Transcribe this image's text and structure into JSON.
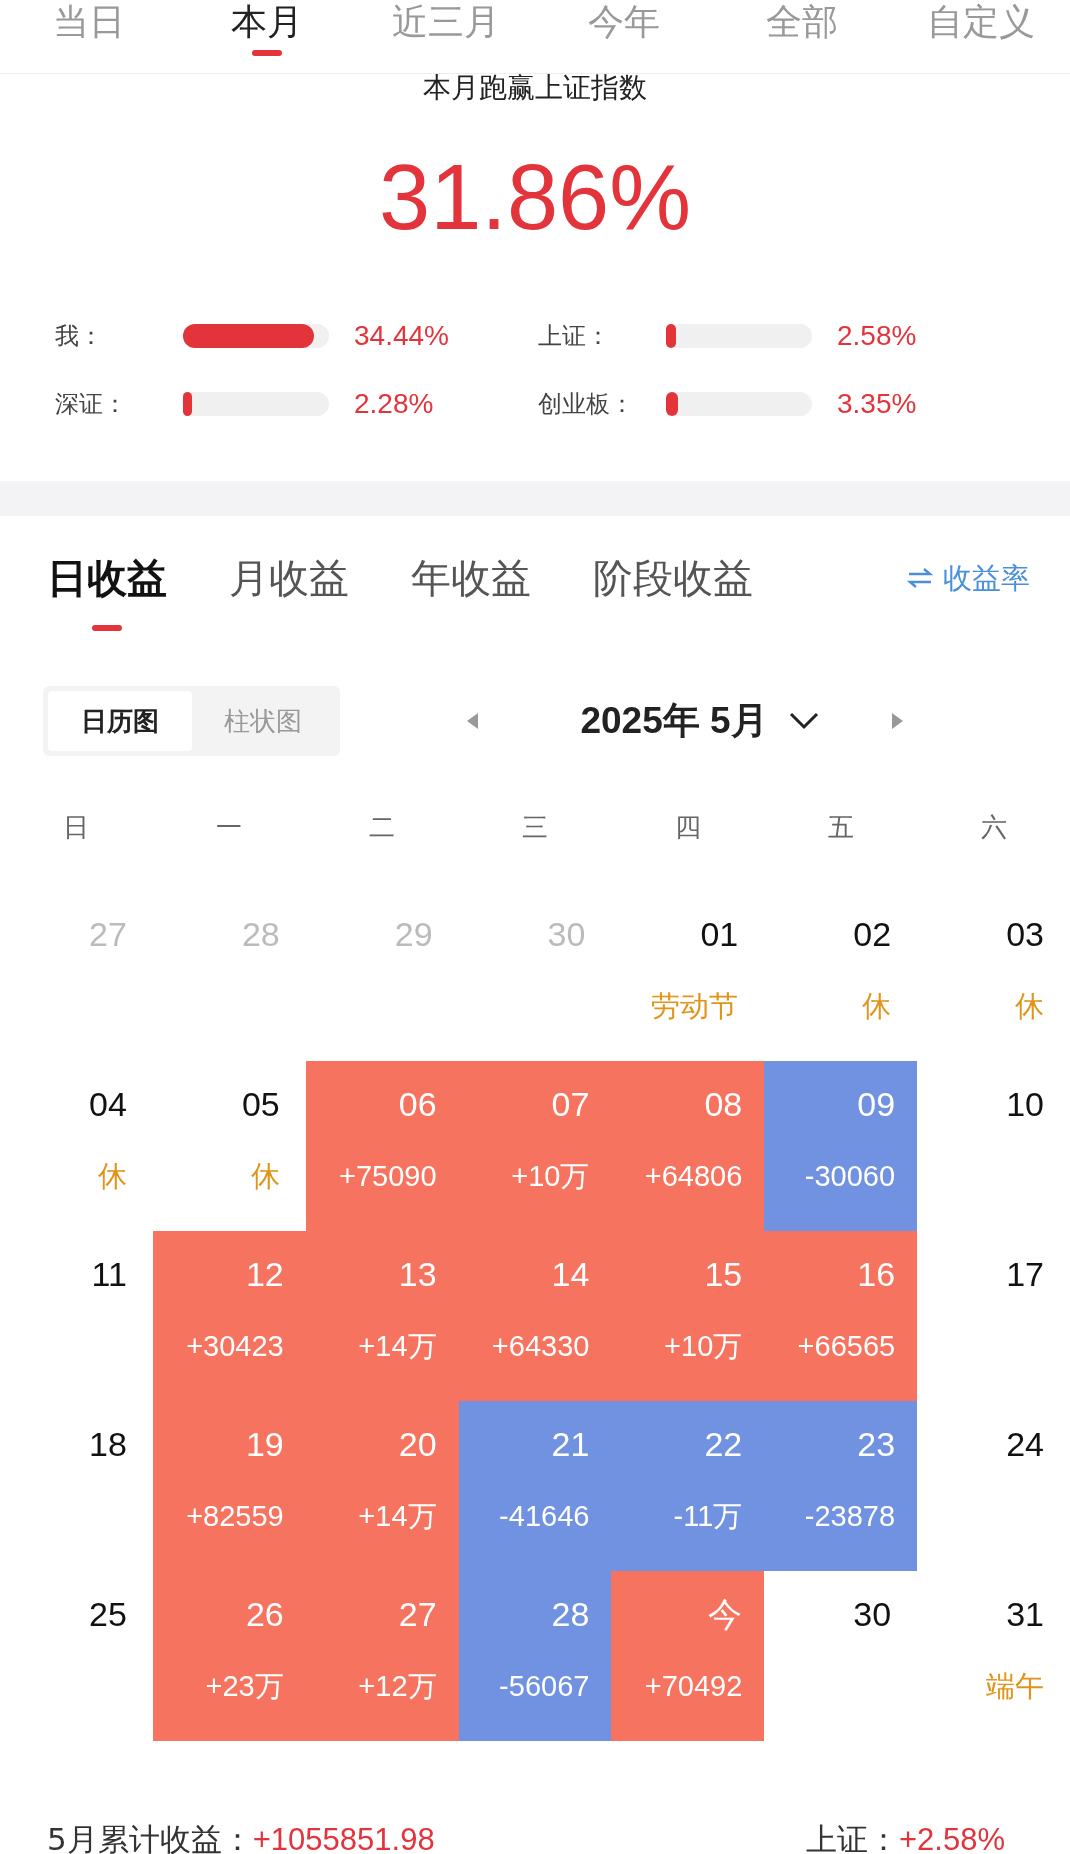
{
  "period_tabs": [
    {
      "label": "当日",
      "selected": false
    },
    {
      "label": "本月",
      "selected": true
    },
    {
      "label": "近三月",
      "selected": false
    },
    {
      "label": "今年",
      "selected": false
    },
    {
      "label": "全部",
      "selected": false
    },
    {
      "label": "自定义",
      "selected": false
    }
  ],
  "summary": {
    "title": "本月跑赢上证指数",
    "value": "31.86%"
  },
  "comparisons": [
    {
      "label": "我：",
      "level": 0.9,
      "value": "34.44%"
    },
    {
      "label": "上证：",
      "level": 0.07,
      "value": "2.58%"
    },
    {
      "label": "深证：",
      "level": 0.06,
      "value": "2.28%"
    },
    {
      "label": "创业板：",
      "level": 0.08,
      "value": "3.35%"
    }
  ],
  "profit_tabs": [
    {
      "label": "日收益",
      "selected": true
    },
    {
      "label": "月收益",
      "selected": false
    },
    {
      "label": "年收益",
      "selected": false
    },
    {
      "label": "阶段收益",
      "selected": false
    }
  ],
  "rate_link": {
    "label": "收益率"
  },
  "view_toggle": [
    {
      "label": "日历图",
      "selected": true
    },
    {
      "label": "柱状图",
      "selected": false
    }
  ],
  "month_nav": {
    "title": "2025年 5月"
  },
  "weekdays": [
    "日",
    "一",
    "二",
    "三",
    "四",
    "五",
    "六"
  ],
  "weeks": [
    [
      {
        "date": "27",
        "kind": "other"
      },
      {
        "date": "28",
        "kind": "other"
      },
      {
        "date": "29",
        "kind": "other"
      },
      {
        "date": "30",
        "kind": "other"
      },
      {
        "date": "01",
        "kind": "plain",
        "label": "劳动节"
      },
      {
        "date": "02",
        "kind": "plain",
        "label": "休"
      },
      {
        "date": "03",
        "kind": "plain",
        "label": "休"
      }
    ],
    [
      {
        "date": "04",
        "kind": "plain",
        "label": "休"
      },
      {
        "date": "05",
        "kind": "plain",
        "label": "休"
      },
      {
        "date": "06",
        "kind": "gain",
        "label": "+75090"
      },
      {
        "date": "07",
        "kind": "gain",
        "label": "+10万"
      },
      {
        "date": "08",
        "kind": "gain",
        "label": "+64806"
      },
      {
        "date": "09",
        "kind": "loss",
        "label": "-30060"
      },
      {
        "date": "10",
        "kind": "plain"
      }
    ],
    [
      {
        "date": "11",
        "kind": "plain"
      },
      {
        "date": "12",
        "kind": "gain",
        "label": "+30423"
      },
      {
        "date": "13",
        "kind": "gain",
        "label": "+14万"
      },
      {
        "date": "14",
        "kind": "gain",
        "label": "+64330"
      },
      {
        "date": "15",
        "kind": "gain",
        "label": "+10万"
      },
      {
        "date": "16",
        "kind": "gain",
        "label": "+66565"
      },
      {
        "date": "17",
        "kind": "plain"
      }
    ],
    [
      {
        "date": "18",
        "kind": "plain"
      },
      {
        "date": "19",
        "kind": "gain",
        "label": "+82559"
      },
      {
        "date": "20",
        "kind": "gain",
        "label": "+14万"
      },
      {
        "date": "21",
        "kind": "loss",
        "label": "-41646"
      },
      {
        "date": "22",
        "kind": "loss",
        "label": "-11万"
      },
      {
        "date": "23",
        "kind": "loss",
        "label": "-23878"
      },
      {
        "date": "24",
        "kind": "plain"
      }
    ],
    [
      {
        "date": "25",
        "kind": "plain"
      },
      {
        "date": "26",
        "kind": "gain",
        "label": "+23万"
      },
      {
        "date": "27",
        "kind": "gain",
        "label": "+12万"
      },
      {
        "date": "28",
        "kind": "loss",
        "label": "-56067"
      },
      {
        "date": "今",
        "kind": "gain",
        "label": "+70492"
      },
      {
        "date": "30",
        "kind": "plain"
      },
      {
        "date": "31",
        "kind": "plain",
        "label": "端午"
      }
    ]
  ],
  "footer": {
    "total_label": "5月累计收益：",
    "total_value": "+1055851.98",
    "index_label": "上证：",
    "index_value": "+2.58%"
  }
}
